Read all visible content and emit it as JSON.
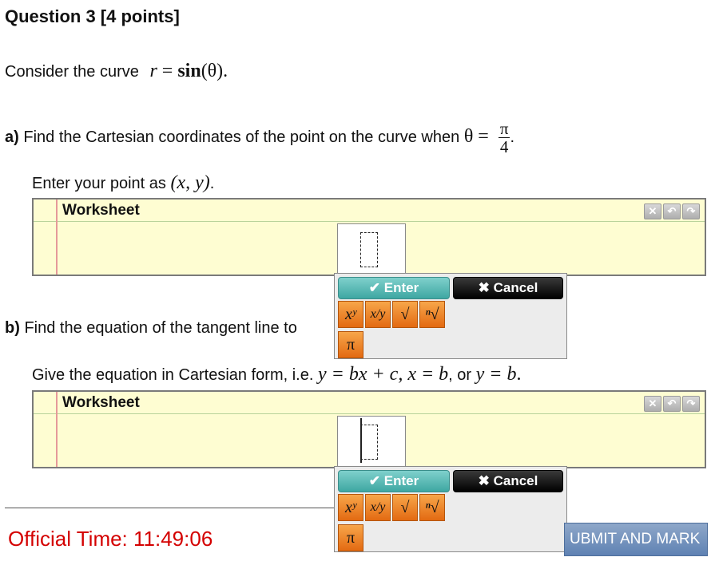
{
  "question": {
    "title": "Question 3 [4 points]",
    "intro": "Consider the curve",
    "curve_r": "r",
    "curve_eq": " = ",
    "curve_func": "sin",
    "curve_arg": "(θ)",
    "curve_end": "."
  },
  "part_a": {
    "label": "a)",
    "text": " Find the Cartesian coordinates of the point on the curve when ",
    "theta": "θ = ",
    "frac_num": "π",
    "frac_den": "4",
    "end": ".",
    "instruction": "Enter your point as",
    "format": "(x, y)",
    "format_end": "."
  },
  "part_b": {
    "label": "b)",
    "text": " Find the equation of the tangent line to",
    "instruction": "Give the equation in Cartesian form, i.e.",
    "forms": "y = bx + c, x = b",
    "or": ", or",
    "form3": "y = b",
    "form3_end": "."
  },
  "worksheet": {
    "title": "Worksheet"
  },
  "palette": {
    "enter_label": "✔ Enter",
    "cancel_label": "✖ Cancel",
    "keys": [
      "xʸ",
      "x/y",
      "√",
      "ⁿ√"
    ],
    "pi": "π"
  },
  "footer": {
    "time_label": "Official Time: 11:49:06",
    "submit_label": "UBMIT AND MARK"
  },
  "colors": {
    "time": "#d40000",
    "worksheet_bg": "#fefdd2",
    "enter": "#3ea7a2",
    "key": "#e36a12"
  }
}
